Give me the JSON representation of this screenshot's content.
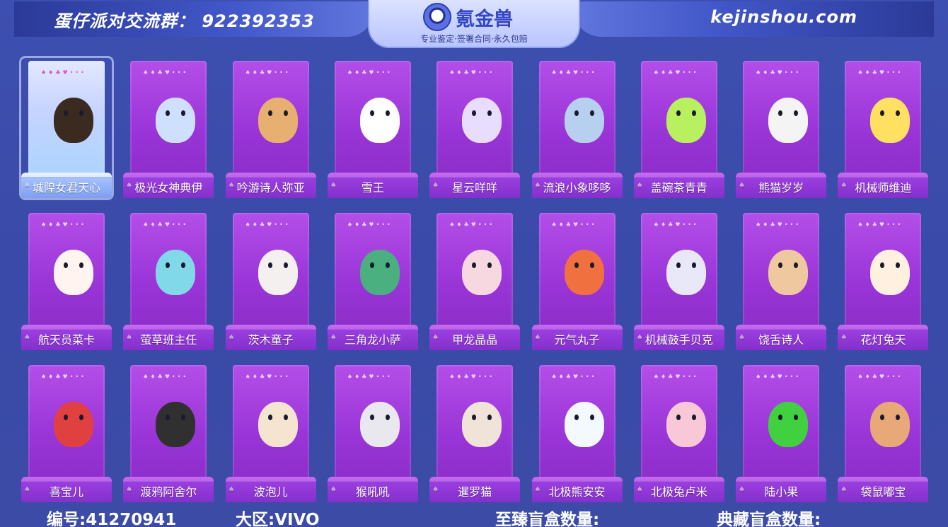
{
  "header": {
    "group_text": "蛋仔派对交流群：  922392353",
    "logo_name": "氪金兽",
    "logo_subtitle": "专业鉴定·签署合同·永久包赔",
    "site": "kejinshou.com"
  },
  "cards": [
    {
      "name": "城隍女君天心",
      "color": "#3a2a20"
    },
    {
      "name": "极光女神典伊",
      "color": "#cfe0ff"
    },
    {
      "name": "吟游诗人弥亚",
      "color": "#e8b070"
    },
    {
      "name": "雪王",
      "color": "#ffffff"
    },
    {
      "name": "星云咩咩",
      "color": "#e8dcff"
    },
    {
      "name": "流浪小象哆哆",
      "color": "#b8d0f0"
    },
    {
      "name": "盖碗茶青青",
      "color": "#b8f060"
    },
    {
      "name": "熊猫岁岁",
      "color": "#f4f4f4"
    },
    {
      "name": "机械师维迪",
      "color": "#ffe060"
    },
    {
      "name": "航天员菜卡",
      "color": "#fff4f0"
    },
    {
      "name": "萤草班主任",
      "color": "#80d8e8"
    },
    {
      "name": "茨木童子",
      "color": "#f4f0f0"
    },
    {
      "name": "三角龙小萨",
      "color": "#4ab080"
    },
    {
      "name": "甲龙晶晶",
      "color": "#f8d8e0"
    },
    {
      "name": "元气丸子",
      "color": "#f07040"
    },
    {
      "name": "机械鼓手贝克",
      "color": "#e8e8f8"
    },
    {
      "name": "饶舌诗人",
      "color": "#f0c8a0"
    },
    {
      "name": "花灯兔天",
      "color": "#fff0e0"
    },
    {
      "name": "喜宝儿",
      "color": "#e04040"
    },
    {
      "name": "渡鸦阿舍尔",
      "color": "#303030"
    },
    {
      "name": "波泡儿",
      "color": "#f4e4d0"
    },
    {
      "name": "猴吼吼",
      "color": "#e8e8ee"
    },
    {
      "name": "暹罗猫",
      "color": "#f0e4d8"
    },
    {
      "name": "北极熊安安",
      "color": "#f4f8ff"
    },
    {
      "name": "北极兔卢米",
      "color": "#f8c8d8"
    },
    {
      "name": "陆小果",
      "color": "#40d040"
    },
    {
      "name": "袋鼠嘟宝",
      "color": "#e8a878"
    }
  ],
  "footer": {
    "id_text": "编号:41270941",
    "region_text": "大区:VIVO",
    "box1_text": "至臻盲盒数量:",
    "box2_text": "典藏盲盒数量:"
  }
}
